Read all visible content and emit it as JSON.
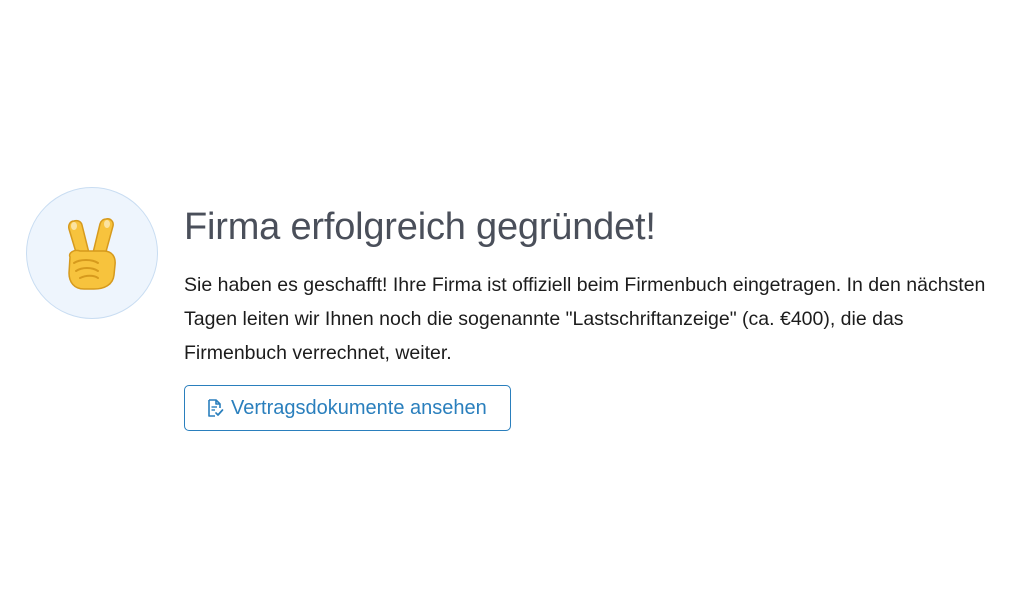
{
  "success": {
    "icon": "victory-hand-emoji",
    "title": "Firma erfolgreich gegründet!",
    "message": "Sie haben es geschafft! Ihre Firma ist offiziell beim Firmenbuch eingetragen. In den nächsten Tagen leiten wir Ihnen noch die sogenannte \"Lastschriftanzeige\" (ca. €400), die das Firmenbuch verrechnet, weiter.",
    "button": {
      "icon": "document-check-icon",
      "label": "Vertragsdokumente ansehen"
    }
  },
  "colors": {
    "title": "#4a4f5a",
    "accent": "#2a7fbd",
    "avatar_bg": "#eef5fd",
    "avatar_border": "#c9ddf2"
  }
}
